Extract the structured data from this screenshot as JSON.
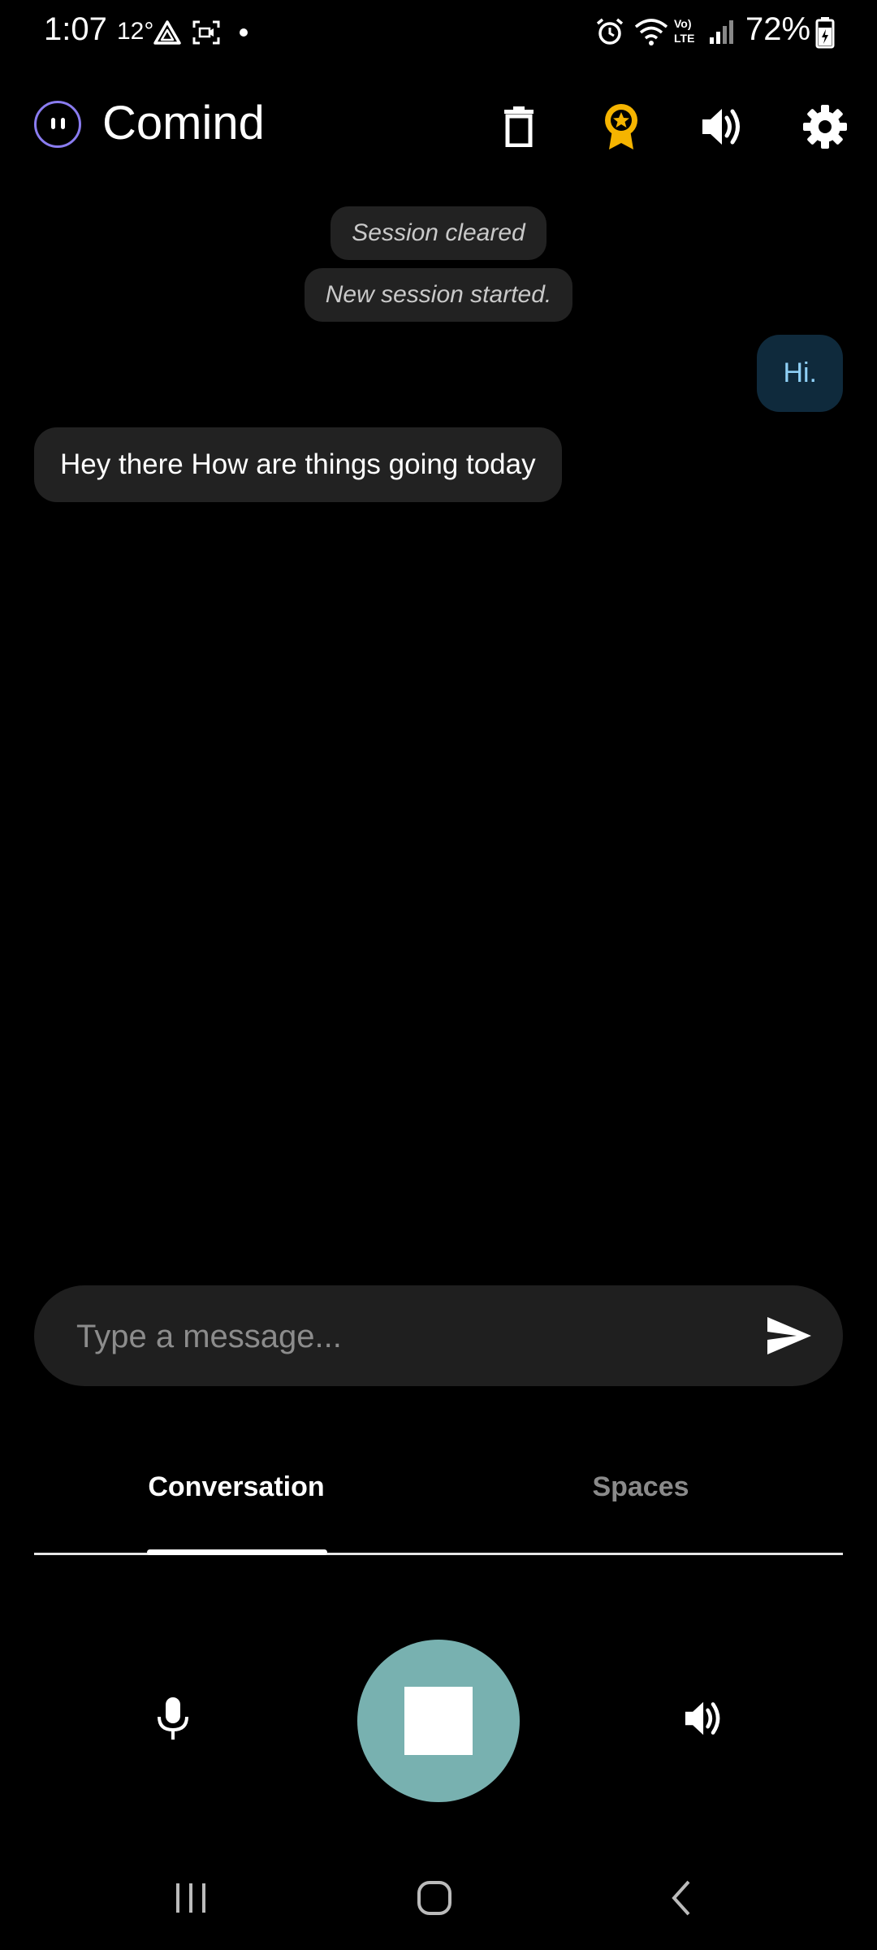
{
  "status_bar": {
    "time": "1:07",
    "temperature": "12°",
    "battery": "72%"
  },
  "header": {
    "title": "Comind",
    "icons": [
      "delete-icon",
      "award-icon",
      "volume-icon",
      "settings-icon"
    ],
    "award_color": "#f5b400"
  },
  "messages": {
    "system": [
      "Session cleared",
      "New session started."
    ],
    "user": "Hi.",
    "assistant": "Hey there How are things going today"
  },
  "composer": {
    "placeholder": "Type a message..."
  },
  "tabs": [
    {
      "label": "Conversation",
      "active": true
    },
    {
      "label": "Spaces",
      "active": false
    }
  ],
  "controls": {
    "record_color": "#78b1b0"
  }
}
